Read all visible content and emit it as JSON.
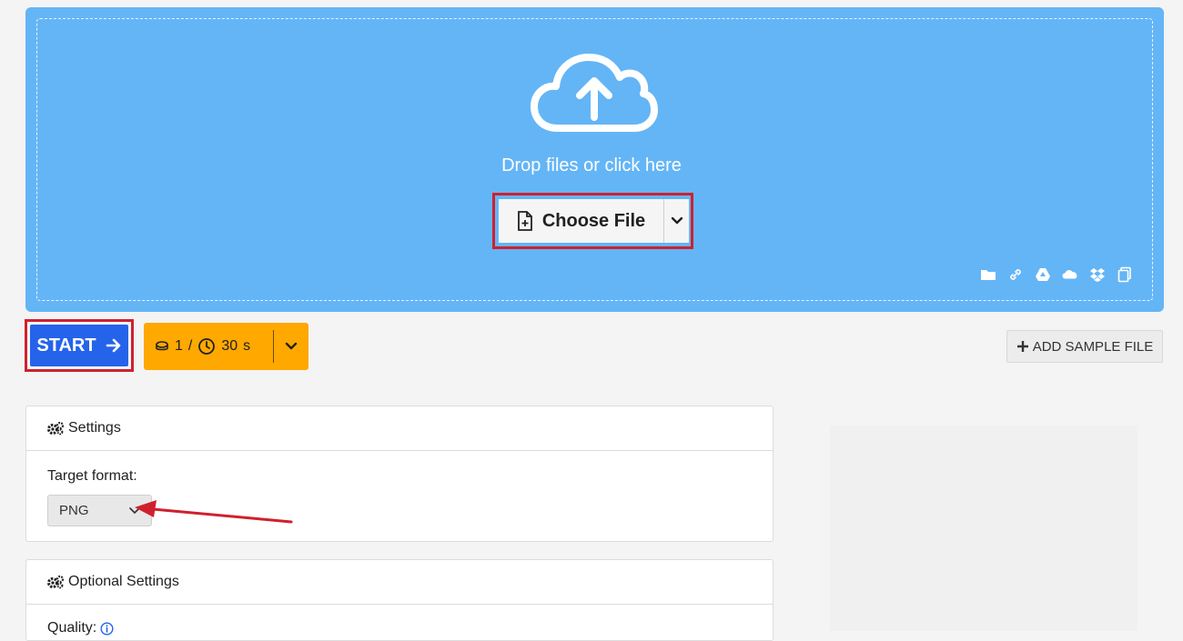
{
  "upload": {
    "prompt": "Drop files or click here",
    "choose_label": "Choose File",
    "icons": [
      "cloud-upload-icon",
      "file-plus-icon",
      "chevron-down-icon"
    ],
    "sources": [
      "folder-icon",
      "link-icon",
      "google-drive-icon",
      "onedrive-icon",
      "dropbox-icon",
      "clipboard-icon"
    ]
  },
  "actions": {
    "start_label": "START",
    "credits_count": "1",
    "credits_sep": "/",
    "credits_time": "30",
    "credits_unit": "s",
    "add_sample_label": "ADD SAMPLE FILE"
  },
  "settings": {
    "title": "Settings",
    "target_format_label": "Target format:",
    "target_format_value": "PNG"
  },
  "optional_settings": {
    "title": "Optional Settings",
    "quality_label": "Quality:"
  },
  "colors": {
    "dropzone": "#64b5f6",
    "start": "#2563eb",
    "credits": "#ffa800",
    "highlight": "#d0202e"
  }
}
